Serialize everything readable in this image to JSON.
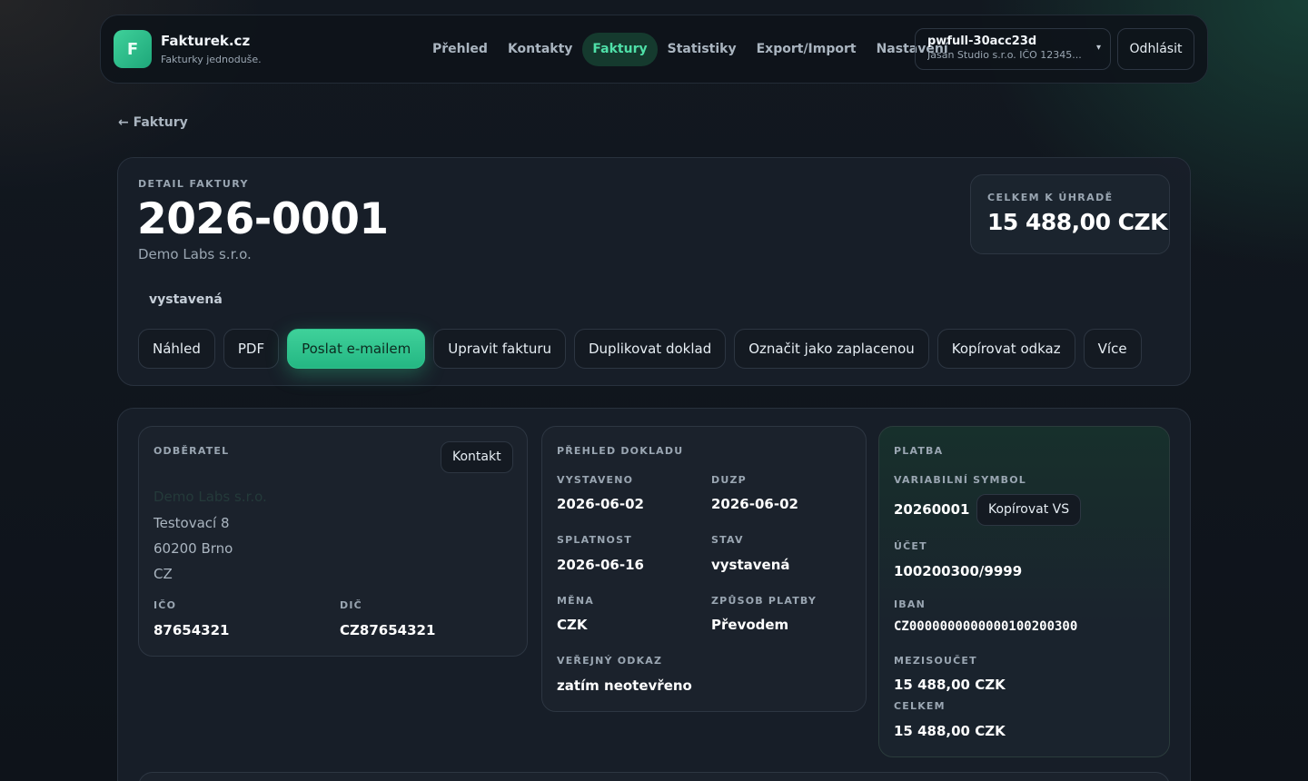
{
  "brand": {
    "logo_letter": "F",
    "name": "Fakturek.cz",
    "tagline": "Fakturky jednoduše."
  },
  "nav": {
    "items": [
      {
        "label": "Přehled"
      },
      {
        "label": "Kontakty"
      },
      {
        "label": "Faktury",
        "active": true
      },
      {
        "label": "Statistiky"
      },
      {
        "label": "Export/Import"
      },
      {
        "label": "Nastavení"
      }
    ]
  },
  "account": {
    "name": "pwfull-30acc23d",
    "subtitle": "Jasan Studio s.r.o. IČO 12345...",
    "caret": "▾"
  },
  "logout_label": "Odhlásit",
  "back_label": "← Faktury",
  "invoice": {
    "eyebrow": "DETAIL FAKTURY",
    "number": "2026-0001",
    "client": "Demo Labs s.r.o.",
    "status": "vystavená",
    "total_label": "CELKEM K ÚHRADĚ",
    "total_value": "15 488,00 CZK"
  },
  "actions": {
    "preview": "Náhled",
    "pdf": "PDF",
    "send_email": "Poslat e-mailem",
    "edit": "Upravit fakturu",
    "duplicate": "Duplikovat doklad",
    "mark_paid": "Označit jako zaplacenou",
    "copy_link": "Kopírovat odkaz",
    "more": "Více"
  },
  "customer": {
    "eyebrow": "ODBĚRATEL",
    "contact_button": "Kontakt",
    "name": "Demo Labs s.r.o.",
    "street": "Testovací 8",
    "city": "60200 Brno",
    "country": "CZ",
    "ico_label": "IČO",
    "ico": "87654321",
    "dic_label": "DIČ",
    "dic": "CZ87654321"
  },
  "overview": {
    "eyebrow": "PŘEHLED DOKLADU",
    "issued_label": "VYSTAVENO",
    "issued": "2026-06-02",
    "duzp_label": "DUZP",
    "duzp": "2026-06-02",
    "due_label": "SPLATNOST",
    "due": "2026-06-16",
    "state_label": "STAV",
    "state": "vystavená",
    "currency_label": "MĚNA",
    "currency": "CZK",
    "method_label": "ZPŮSOB PLATBY",
    "method": "Převodem",
    "public_label": "VEŘEJNÝ ODKAZ",
    "public": "zatím neotevřeno"
  },
  "payment": {
    "eyebrow": "PLATBA",
    "vs_label": "VARIABILNÍ SYMBOL",
    "vs": "20260001",
    "copy_vs": "Kopírovat VS",
    "account_label": "ÚČET",
    "account": "100200300/9999",
    "iban_label": "IBAN",
    "iban": "CZ0000000000000100200300",
    "subtotal_label": "MEZISOUČET",
    "subtotal": "15 488,00 CZK",
    "total_label": "CELKEM",
    "total": "15 488,00 CZK"
  }
}
